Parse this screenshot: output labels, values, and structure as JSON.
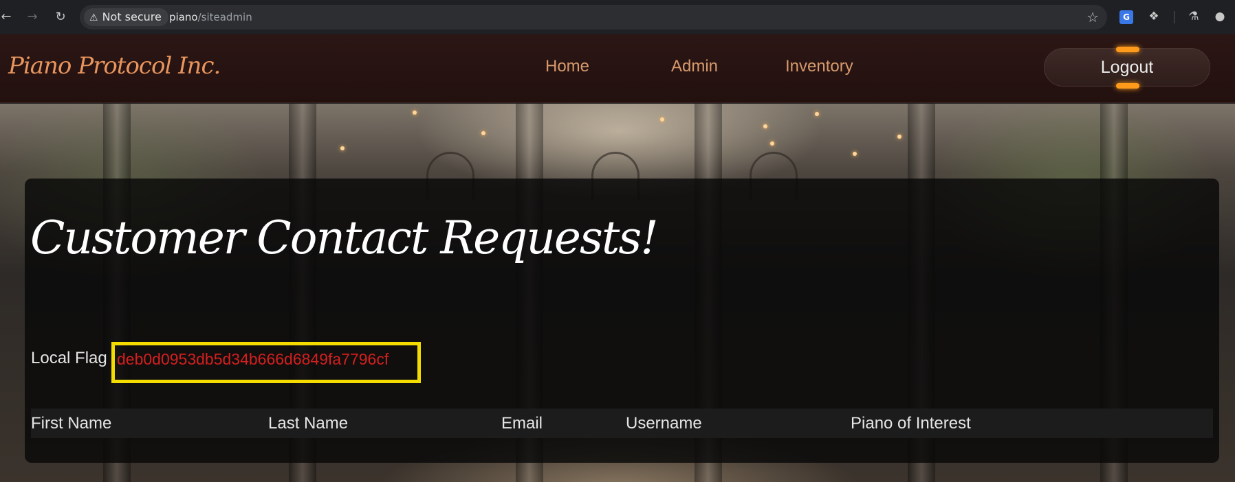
{
  "browser": {
    "security_label": "Not secure",
    "url_host": "piano",
    "url_path": "/siteadmin",
    "translate_badge": "G",
    "icons": [
      "back-arrow-icon",
      "forward-arrow-icon",
      "reload-icon",
      "warning-icon",
      "bookmark-star-icon",
      "translate-icon",
      "extensions-puzzle-icon",
      "labs-flask-icon",
      "profile-icon"
    ]
  },
  "site": {
    "logo": "Piano Protocol Inc.",
    "nav": [
      "Home",
      "Admin",
      "Inventory"
    ],
    "logout_label": "Logout"
  },
  "main": {
    "title": "Customer Contact Requests!",
    "flag_label": "Local Flag :",
    "flag_value": "deb0d0953db5d34b666d6849fa7796cf",
    "table_headers": [
      "First Name",
      "Last Name",
      "Email",
      "Username",
      "Piano of Interest"
    ],
    "table_rows": []
  },
  "colors": {
    "accent_orange": "#d79a6c",
    "flag_red": "#d41f1f",
    "highlight_yellow": "#f4dc00",
    "logout_glow": "#ff9a1a"
  }
}
